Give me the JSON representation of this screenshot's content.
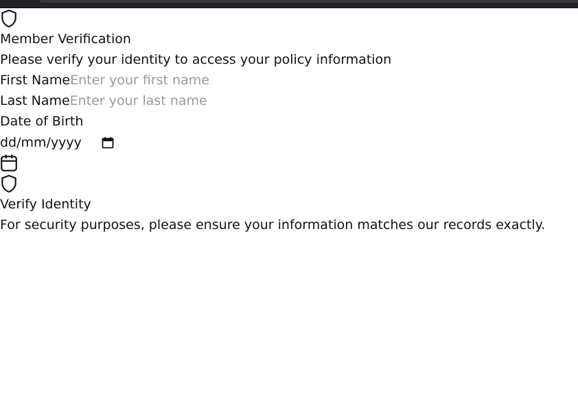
{
  "header": {
    "title": "Member Verification",
    "subtitle": "Please verify your identity to access your policy information"
  },
  "form": {
    "first_name": {
      "label": "First Name",
      "value": "",
      "placeholder": "Enter your first name"
    },
    "last_name": {
      "label": "Last Name",
      "value": "",
      "placeholder": "Enter your last name"
    },
    "dob": {
      "label": "Date of Birth",
      "value": "",
      "placeholder": "dd/mm/yyyy"
    }
  },
  "button": {
    "label": "Verify Identity"
  },
  "notice": {
    "text": "For security purposes, please ensure your information matches our records exactly."
  },
  "icons": {
    "header": "shield-icon",
    "date_picker": "calendar-icon",
    "calendar": "calendar-icon",
    "button": "shield-icon"
  },
  "colors": {
    "text": "#111111",
    "placeholder": "#9a9a9a",
    "topbar": "#222326"
  }
}
